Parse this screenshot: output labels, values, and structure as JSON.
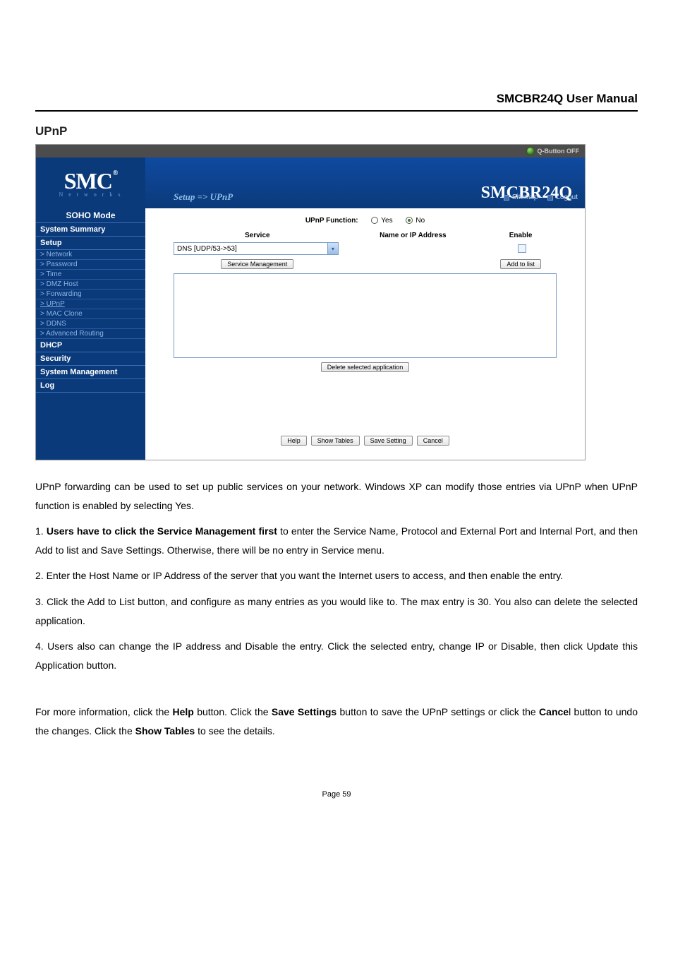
{
  "doc": {
    "header": "SMCBR24Q User Manual",
    "section_title": "UPnP",
    "para1": "UPnP forwarding can be used to set up public services on your network. Windows XP can modify those entries via UPnP when UPnP function is enabled by selecting Yes.",
    "p2_prefix": "1.   ",
    "p2_bold": "Users have to click the Service Management first",
    "p2_rest": " to enter the Service Name, Protocol and External Port and Internal Port, and then Add to list and Save Settings. Otherwise, there will be no entry in Service menu.",
    "para3": "2.   Enter the Host Name or IP Address of the server that you want the Internet users to access, and then enable the entry.",
    "para4": "3.   Click the Add to List button, and configure as many entries as you would like to. The max entry is 30. You also can delete the selected application.",
    "para5": "4.   Users also can change the IP address and Disable the entry. Click the selected entry, change IP or Disable, then click Update this Application button.",
    "fin_a": "For more information, click the ",
    "fin_help": "Help",
    "fin_b": " button. Click the ",
    "fin_save": "Save Settings",
    "fin_c": " button to save the UPnP settings or click the ",
    "fin_cancel": "Cance",
    "fin_d": "l button to undo the changes. Click the ",
    "fin_show": "Show Tables",
    "fin_e": " to see the details.",
    "page_num": "Page 59"
  },
  "ui": {
    "qbutton": "Q-Button OFF",
    "logo_main": "SMC",
    "logo_sub": "N e t w o r k s",
    "breadcrumb": "Setup => UPnP",
    "model": "SMCBR24Q",
    "link_sitemap": "Sitemap",
    "link_logout": "Logout",
    "nav": {
      "soho": "SOHO Mode",
      "system_summary": "System Summary",
      "setup": "Setup",
      "items": {
        "network": "> Network",
        "password": "> Password",
        "time": "> Time",
        "dmz": "> DMZ Host",
        "forwarding": "> Forwarding",
        "upnp": "> UPnP",
        "mac": "> MAC Clone",
        "ddns": "> DDNS",
        "advrouting": "> Advanced Routing"
      },
      "dhcp": "DHCP",
      "security": "Security",
      "sysmgmt": "System Management",
      "log": "Log"
    },
    "panel": {
      "func_label": "UPnP Function:",
      "yes": "Yes",
      "no": "No",
      "col_service": "Service",
      "col_ip": "Name or IP Address",
      "col_enable": "Enable",
      "select_value": "DNS [UDP/53->53]",
      "btn_service_mgmt": "Service Management",
      "btn_add": "Add to list",
      "btn_delete": "Delete selected application",
      "btn_help": "Help",
      "btn_show": "Show Tables",
      "btn_save": "Save Setting",
      "btn_cancel": "Cancel"
    }
  }
}
